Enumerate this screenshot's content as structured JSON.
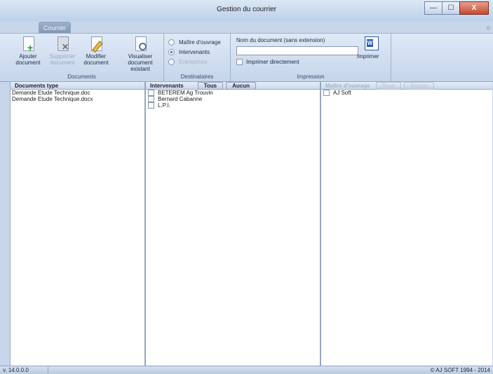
{
  "window": {
    "title": "Gestion du courrier",
    "minimize": "—",
    "maximize": "☐",
    "close": "X"
  },
  "ribbon": {
    "tab": "Courrier",
    "help": "⌂",
    "groups": {
      "documents": {
        "label": "Documents",
        "add": "Ajouter document",
        "delete": "Supprimer document",
        "modify": "Modifier document",
        "view": "Visualiser document existant"
      },
      "destinataires": {
        "label": "Destinataires",
        "options": [
          "Maître d'ouvrage",
          "Intervenants",
          "Entreprises"
        ],
        "selected": "Intervenants"
      },
      "impression": {
        "label": "Impression",
        "docname_label": "Nom du document (sans extension)",
        "docname_value": "",
        "print_direct": "Imprimer directement",
        "print": "Imprimer"
      }
    }
  },
  "panes": {
    "documents_type": {
      "header": "Documents type",
      "items": [
        "Demande Etude Technique.doc",
        "Demande Etude Technique.docx"
      ]
    },
    "intervenants": {
      "header": "Intervenants",
      "all": "Tous",
      "none": "Aucun",
      "items": [
        "BETEREM Ag Trouvin",
        "Bernard Cabanne",
        "L.P.I."
      ]
    },
    "maitre_ouvrage": {
      "header": "Maître d'ouvrage",
      "all": "Tous",
      "none": "Aucun",
      "items": [
        "AJ Soft"
      ]
    }
  },
  "status": {
    "version": "v. 14.0.0.0",
    "copyright": "© AJ SOFT 1994 - 2014"
  },
  "colors": {
    "ribbon_bg": "#c5d5eb",
    "accent": "#2b66b8",
    "close_button": "#c34a32"
  }
}
